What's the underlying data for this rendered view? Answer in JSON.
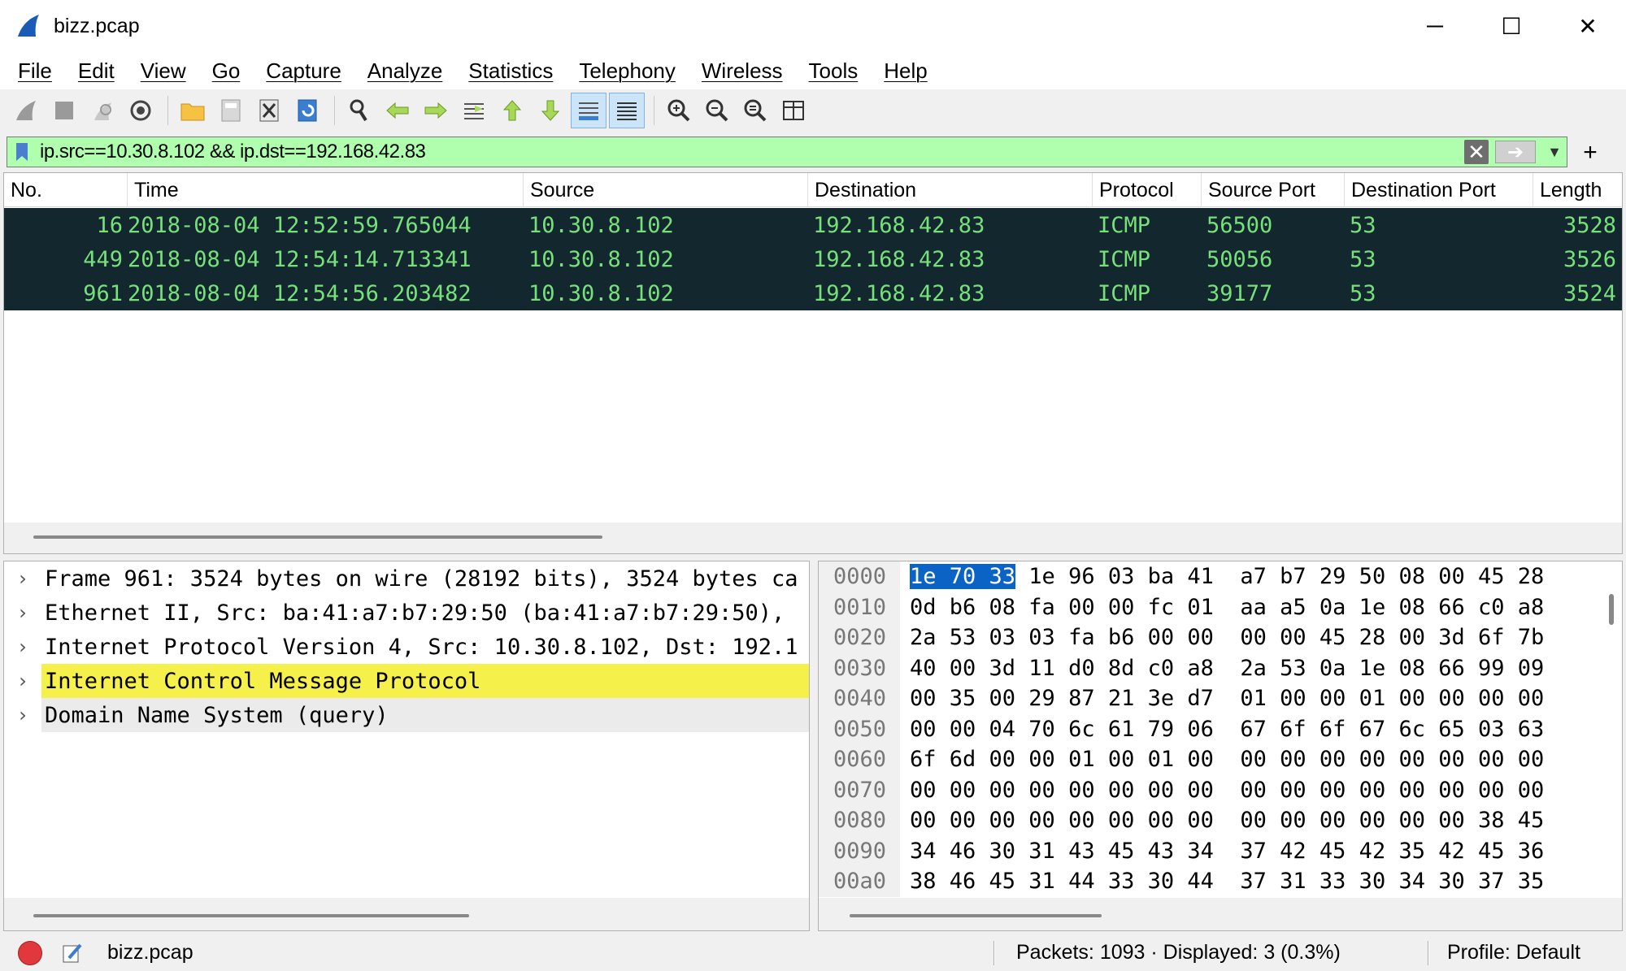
{
  "window": {
    "title": "bizz.pcap",
    "minimize_glyph": "─",
    "maximize_glyph": "☐",
    "close_glyph": "✕"
  },
  "menu": [
    "File",
    "Edit",
    "View",
    "Go",
    "Capture",
    "Analyze",
    "Statistics",
    "Telephony",
    "Wireless",
    "Tools",
    "Help"
  ],
  "toolbar": {
    "icons": [
      "shark-fin-start-icon",
      "stop-capture-icon",
      "restart-capture-icon",
      "capture-options-icon",
      "open-file-icon",
      "save-file-icon",
      "close-file-icon",
      "reload-file-icon",
      "find-packet-icon",
      "go-back-icon",
      "go-forward-icon",
      "go-to-packet-icon",
      "first-packet-icon",
      "last-packet-icon",
      "auto-scroll-icon",
      "colorize-icon",
      "zoom-in-icon",
      "zoom-out-icon",
      "normal-size-icon",
      "resize-columns-icon"
    ]
  },
  "filter": {
    "value": "ip.src==10.30.8.102 && ip.dst==192.168.42.83",
    "add_glyph": "+"
  },
  "packet_list": {
    "columns": [
      "No.",
      "Time",
      "Source",
      "Destination",
      "Protocol",
      "Source Port",
      "Destination Port",
      "Length"
    ],
    "rows": [
      {
        "no": "16",
        "time": "2018-08-04 12:52:59.765044",
        "source": "10.30.8.102",
        "destination": "192.168.42.83",
        "protocol": "ICMP",
        "sport": "56500",
        "dport": "53",
        "length": "3528"
      },
      {
        "no": "449",
        "time": "2018-08-04 12:54:14.713341",
        "source": "10.30.8.102",
        "destination": "192.168.42.83",
        "protocol": "ICMP",
        "sport": "50056",
        "dport": "53",
        "length": "3526"
      },
      {
        "no": "961",
        "time": "2018-08-04 12:54:56.203482",
        "source": "10.30.8.102",
        "destination": "192.168.42.83",
        "protocol": "ICMP",
        "sport": "39177",
        "dport": "53",
        "length": "3524"
      }
    ]
  },
  "details": [
    "Frame 961: 3524 bytes on wire (28192 bits), 3524 bytes ca",
    "Ethernet II, Src: ba:41:a7:b7:29:50 (ba:41:a7:b7:29:50),",
    "Internet Protocol Version 4, Src: 10.30.8.102, Dst: 192.1",
    "Internet Control Message Protocol",
    "Domain Name System (query)"
  ],
  "hex": [
    {
      "offset": "0000",
      "sel": "1e 70 33",
      "rest": " 1e 96 03 ba 41  a7 b7 29 50 08 00 45 28"
    },
    {
      "offset": "0010",
      "sel": "",
      "rest": "0d b6 08 fa 00 00 fc 01  aa a5 0a 1e 08 66 c0 a8"
    },
    {
      "offset": "0020",
      "sel": "",
      "rest": "2a 53 03 03 fa b6 00 00  00 00 45 28 00 3d 6f 7b"
    },
    {
      "offset": "0030",
      "sel": "",
      "rest": "40 00 3d 11 d0 8d c0 a8  2a 53 0a 1e 08 66 99 09"
    },
    {
      "offset": "0040",
      "sel": "",
      "rest": "00 35 00 29 87 21 3e d7  01 00 00 01 00 00 00 00"
    },
    {
      "offset": "0050",
      "sel": "",
      "rest": "00 00 04 70 6c 61 79 06  67 6f 6f 67 6c 65 03 63"
    },
    {
      "offset": "0060",
      "sel": "",
      "rest": "6f 6d 00 00 01 00 01 00  00 00 00 00 00 00 00 00"
    },
    {
      "offset": "0070",
      "sel": "",
      "rest": "00 00 00 00 00 00 00 00  00 00 00 00 00 00 00 00"
    },
    {
      "offset": "0080",
      "sel": "",
      "rest": "00 00 00 00 00 00 00 00  00 00 00 00 00 00 38 45"
    },
    {
      "offset": "0090",
      "sel": "",
      "rest": "34 46 30 31 43 45 43 34  37 42 45 42 35 42 45 36"
    },
    {
      "offset": "00a0",
      "sel": "",
      "rest": "38 46 45 31 44 33 30 44  37 31 33 30 34 30 37 35"
    }
  ],
  "status": {
    "file": "bizz.pcap",
    "packets": "Packets: 1093 · Displayed: 3 (0.3%)",
    "profile": "Profile: Default"
  },
  "colors": {
    "selected_row_bg": "#12272e",
    "selected_row_fg": "#78e07a",
    "filter_valid_bg": "#afffaf",
    "highlight_tree": "#f5f04a",
    "hex_selection": "#0b63c6"
  }
}
